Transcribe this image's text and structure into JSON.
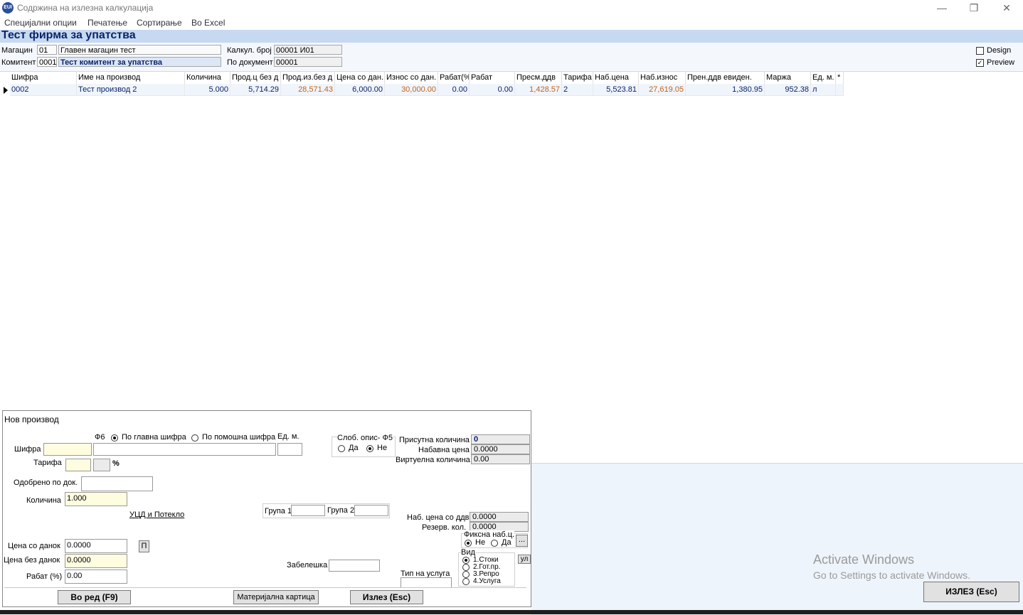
{
  "window": {
    "title": "Содржина на излезна калкулација",
    "icon_text": "EUI",
    "minimize": "—",
    "restore": "❐",
    "close": "✕"
  },
  "menu": [
    "Специјални опции",
    "Печатење",
    "Сортирање",
    "Во Excel"
  ],
  "firm_title": "Тест фирма за упатства",
  "header": {
    "magacin_label": "Магацин",
    "magacin_code": "01",
    "magacin_name": "Главен магацин тест",
    "komitent_label": "Комитент",
    "komitent_code": "0001",
    "komitent_name": "Тест комитент за упатства",
    "kalk_label": "Калкул. број",
    "kalk_value": "00001  И01",
    "dokument_label": "По документ",
    "dokument_value": "00001",
    "design_label": "Design",
    "design_checked": false,
    "preview_label": "Preview",
    "preview_checked": true
  },
  "grid": {
    "columns": [
      "Шифра",
      "Име на производ",
      "Количина",
      "Прод.ц без д",
      "Прод.из.без д",
      "Цена со дан.",
      "Износ со дан.",
      "Рабат(%",
      "Рабат",
      "Пресм.ддв",
      "Тарифа",
      "Наб.цена",
      "Наб.износ",
      "Прен.ддв евиден.",
      "Маржа",
      "Ед. м.",
      "*"
    ],
    "rows": [
      [
        "0002",
        "Тест производ 2",
        "5.000",
        "5,714.29",
        "28,571.43",
        "6,000.00",
        "30,000.00",
        "0.00",
        "0.00",
        "1,428.57",
        "2",
        "5,523.81",
        "27,619.05",
        "1,380.95",
        "952.38",
        "л",
        ""
      ]
    ]
  },
  "panel": {
    "title": "Нов производ",
    "f6_label": "Ф6",
    "radio_main": "По главна шифра",
    "radio_aux": "По помошна шифра",
    "unit_label": "Ед. м.",
    "sifra_label": "Шифра",
    "tarifa_label": "Тарифа",
    "percent": "%",
    "odobreno_label": "Одобрено по док.",
    "kolicina_label": "Количина",
    "kolicina_value": "1.000",
    "ucd_link": "УЦД и Потекло",
    "grupa1_label": "Група 1",
    "grupa2_label": "Група 2",
    "slob_label": "Слоб. опис- Ф5",
    "da": "Да",
    "ne": "Не",
    "prisutna_label": "Присутна количина",
    "prisutna_value": "0",
    "nabavna_label": "Набавна цена",
    "nabavna_value": "0.0000",
    "virtuelna_label": "Виртуелна количина",
    "virtuelna_value": "0.00",
    "nab_ddv_label": "Наб. цена со ддв",
    "nab_ddv_value": "0.0000",
    "rezerv_label": "Резерв. кол.",
    "rezerv_value": "0.0000",
    "fiksna_label": "Фиксна наб.ц.",
    "fiksna_btn": "...",
    "vid_label": "Вид",
    "vid_options": [
      "1.Стоки",
      "2.Гот.пр.",
      "3.Репро",
      "4.Услуга"
    ],
    "ul_btn": "ул",
    "cena_so_label": "Цена со данок",
    "cena_so_value": "0.0000",
    "p_btn": "П",
    "cena_bez_label": "Цена без данок",
    "cena_bez_value": "0.0000",
    "rabat_label": "Рабат (%)",
    "rabat_value": "0.00",
    "zabeleska_label": "Забелешка",
    "tip_label": "Тип на услуга",
    "vo_red_btn": "Во ред (F9)",
    "mat_btn": "Материјална картица",
    "izlez_btn": "Излез (Esc)"
  },
  "exit_main": "ИЗЛЕЗ (Esc)",
  "activate": {
    "line1": "Activate Windows",
    "line2": "Go to Settings to activate Windows."
  }
}
